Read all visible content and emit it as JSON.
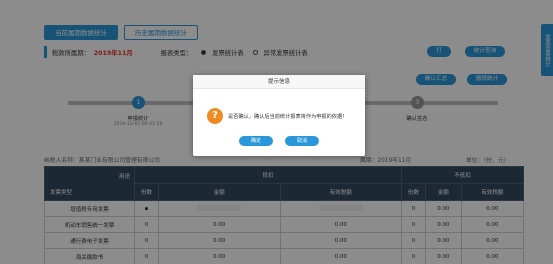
{
  "tabs": [
    {
      "label": "当前属期数据统计",
      "active": true
    },
    {
      "label": "历史属期数据统计",
      "active": false
    }
  ],
  "info": {
    "period_label": "税款所属期：",
    "period_value": "2019年11月",
    "report_type_label": "报表类型：",
    "option_normal": "发票统计表",
    "option_abnormal": "异常发票统计表"
  },
  "buttons": {
    "print": "打印",
    "export": "统计查询",
    "confirm_summary": "确认汇总",
    "undo_stats": "撤销统计"
  },
  "sidetab": "发票查看统计",
  "steps": [
    {
      "num": "1",
      "label": "申报统计",
      "date": "2019-12-05 09:41:19"
    },
    {
      "num": "3",
      "label": "确认签名",
      "date": ""
    }
  ],
  "meta": {
    "taxpayer": "纳税人名称：某某门业有限公司管理有限公司",
    "period": "属期：2019年11月",
    "unit": "单位：（份、元）"
  },
  "table": {
    "corner_top": "用途",
    "corner_bottom": "发票类型",
    "group_deduct": "抵扣",
    "group_nondeduct": "不抵扣",
    "sub_headers": [
      "份数",
      "金额",
      "有效税额",
      "份数",
      "金额",
      "有效税额"
    ],
    "rows": [
      {
        "name": "增值税专用发票",
        "values": [
          "",
          "",
          "",
          "0",
          "0.00",
          "0.00"
        ],
        "masked": true
      },
      {
        "name": "机动车销售统一发票",
        "values": [
          "0",
          "0.00",
          "0.00",
          "0",
          "0.00",
          "0.00"
        ],
        "masked": false
      },
      {
        "name": "通行费电子发票",
        "values": [
          "0",
          "0.00",
          "0.00",
          "0",
          "0.00",
          "0.00"
        ],
        "masked": false
      },
      {
        "name": "海关缴款书",
        "values": [
          "0",
          "0.00",
          "0.00",
          "0",
          "0.00",
          "0.00"
        ],
        "masked": false
      }
    ]
  },
  "dialog": {
    "title": "提示信息",
    "message": "是否确认，确认后当前统计报表将作为申报的依据！",
    "ok": "确定",
    "cancel": "取消"
  },
  "colors": {
    "accent": "#2a97d8",
    "header": "#34495e",
    "warning": "#f08a24",
    "danger": "#e0352b"
  }
}
